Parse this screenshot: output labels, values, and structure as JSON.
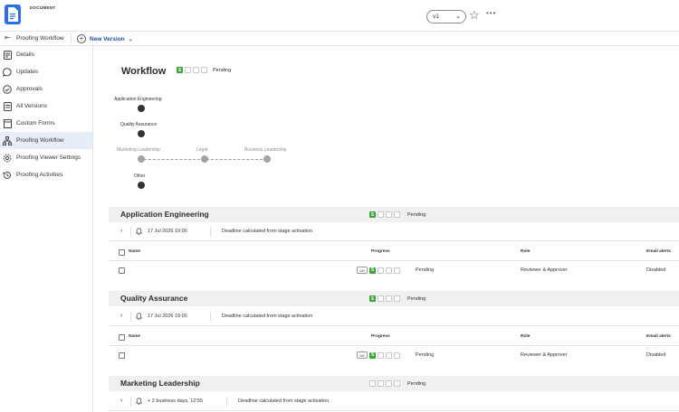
{
  "header": {
    "doc_label": "DOCUMENT",
    "version": "v1",
    "icons": [
      "document-icon",
      "chevron-down-icon",
      "star-icon",
      "more-icon"
    ]
  },
  "subbar": {
    "title": "Proofing Workflow",
    "new_version": "New Version"
  },
  "sidebar": {
    "items": [
      {
        "label": "Details",
        "icon": "details-icon"
      },
      {
        "label": "Updates",
        "icon": "chat-icon"
      },
      {
        "label": "Approvals",
        "icon": "check-circle-icon"
      },
      {
        "label": "All Versions",
        "icon": "versions-icon"
      },
      {
        "label": "Custom Forms",
        "icon": "form-icon"
      },
      {
        "label": "Proofing Workflow",
        "icon": "workflow-icon",
        "active": true
      },
      {
        "label": "Proofing Viewer Settings",
        "icon": "gear-icon"
      },
      {
        "label": "Proofing Activities",
        "icon": "history-icon"
      }
    ]
  },
  "workflow": {
    "title": "Workflow",
    "status_letter": "S",
    "status": "Pending",
    "diagram": {
      "stage1": "Application Engineering",
      "stage2": "Quality Assurance",
      "stage3a": "Marketing Leadership",
      "stage3b": "Legal",
      "stage3c": "Business Leadership",
      "stage4": "Other"
    }
  },
  "columns": {
    "name": "Name",
    "progress": "Progress",
    "role": "Role",
    "email_alerts": "Email alerts"
  },
  "stages": [
    {
      "name": "Application Engineering",
      "status_letter": "S",
      "status": "Pending",
      "deadline": "17 Jul 2026 19:00",
      "deadline_note": "Deadline calculated from stage activation",
      "row": {
        "ratio": "0/0",
        "letter": "S",
        "status": "Pending",
        "role": "Reviewer & Approver",
        "email_alerts": "Disabled"
      }
    },
    {
      "name": "Quality Assurance",
      "status_letter": "S",
      "status": "Pending",
      "deadline": "17 Jul 2026 19:00",
      "deadline_note": "Deadline calculated from stage activation",
      "row": {
        "ratio": "0/0",
        "letter": "S",
        "status": "Pending",
        "role": "Reviewer & Approver",
        "email_alerts": "Disabled"
      }
    },
    {
      "name": "Marketing Leadership",
      "status": "Pending",
      "deadline": "+ 2 business days, 12:55",
      "deadline_note": "Deadline calculated from stage activation"
    }
  ],
  "colors": {
    "accent": "#2e6ee6",
    "link": "#1d4f9c",
    "status_green": "#3aa33a",
    "active_nav_bg": "#e8eef7"
  }
}
